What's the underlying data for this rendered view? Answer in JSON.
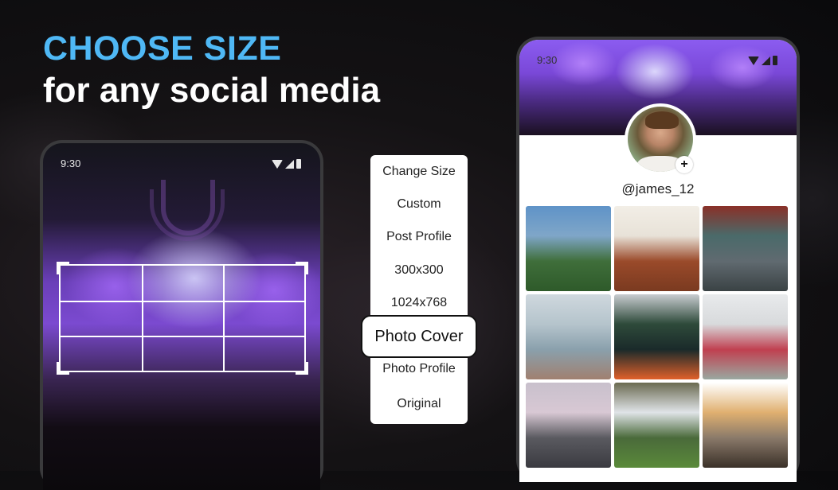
{
  "headline": {
    "title": "CHOOSE SIZE",
    "subtitle": "for any social media"
  },
  "colors": {
    "accent": "#4fb8f5",
    "text": "#ffffff",
    "background": "#0a0a0c"
  },
  "left_phone": {
    "status_time": "9:30",
    "status_icons": [
      "wifi-icon",
      "cellular-signal-icon",
      "battery-icon"
    ],
    "crop_grid": {
      "rows": 3,
      "cols": 3
    }
  },
  "size_menu": {
    "items": [
      {
        "label": "Change Size",
        "selected": false
      },
      {
        "label": "Custom",
        "selected": false
      },
      {
        "label": "Post Profile",
        "selected": false
      },
      {
        "label": "300x300",
        "selected": false
      },
      {
        "label": "1024x768",
        "selected": false
      },
      {
        "label": "Photo Cover",
        "selected": true
      },
      {
        "label": "Photo Profile",
        "selected": false
      },
      {
        "label": "Original",
        "selected": false
      }
    ]
  },
  "right_phone": {
    "status_time": "9:30",
    "status_icons": [
      "wifi-icon",
      "cellular-signal-icon",
      "battery-icon"
    ],
    "username": "@james_12",
    "add_label": "+",
    "photos": [
      {
        "name": "lighthouse-photo",
        "colors": [
          "#5f93c8",
          "#7fa6c8",
          "#3f6e3a",
          "#2e5a2a"
        ]
      },
      {
        "name": "friends-photo",
        "colors": [
          "#f2eee6",
          "#e8e2d8",
          "#9a4a2a",
          "#7a3a20"
        ]
      },
      {
        "name": "cyclist-photo",
        "colors": [
          "#8a3028",
          "#4a6a6a",
          "#606a70",
          "#3a4244"
        ]
      },
      {
        "name": "holding-hands-photo",
        "colors": [
          "#cfd8de",
          "#b5c4cc",
          "#8aa0ac",
          "#a08070"
        ]
      },
      {
        "name": "kayak-fjord-photo",
        "colors": [
          "#c8ccd0",
          "#2e4a3a",
          "#1a2a2a",
          "#e0602a"
        ]
      },
      {
        "name": "friends-laughing-photo",
        "colors": [
          "#e8eaec",
          "#d8dadc",
          "#c04050",
          "#9aa8a0"
        ]
      },
      {
        "name": "mountain-road-photo",
        "colors": [
          "#c8c0cc",
          "#d8c8d4",
          "#5a5a60",
          "#3a3a40"
        ]
      },
      {
        "name": "waterfall-photo",
        "colors": [
          "#6a6a50",
          "#e0e4e8",
          "#4a6a3a",
          "#5a8a3a"
        ]
      },
      {
        "name": "road-map-photo",
        "colors": [
          "#ffffff",
          "#e0b070",
          "#8a7a6a",
          "#3a3028"
        ]
      }
    ]
  }
}
